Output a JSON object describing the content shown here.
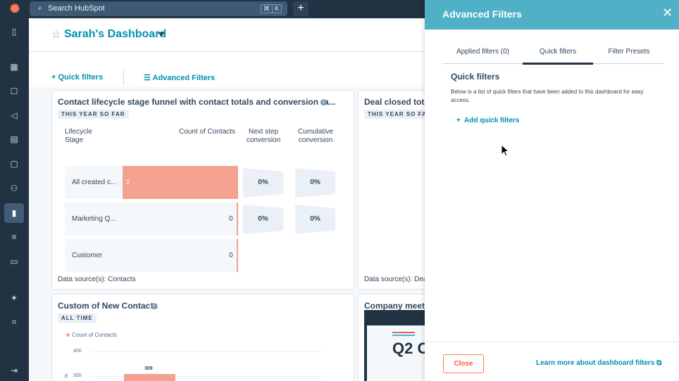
{
  "topbar": {
    "logo_glyph": "✺",
    "search_placeholder": "Search HubSpot",
    "shortcut_cmd": "⌘",
    "shortcut_key": "K",
    "add_glyph": "+"
  },
  "rail_icons": [
    "bookmark-icon",
    "contacts-icon",
    "grid-icon",
    "inbox-icon",
    "megaphone-icon",
    "content-icon",
    "commerce-icon",
    "automation-icon",
    "reports-icon",
    "database-icon",
    "folder-icon",
    "sparkle-icon",
    "code-icon",
    "collapse-icon"
  ],
  "dashboard": {
    "title": "Sarah's Dashboard",
    "filters": {
      "quick": "Quick filters",
      "advanced": "Advanced Filters"
    }
  },
  "card1": {
    "title": "Contact lifecycle stage funnel with contact totals and conversion ra...",
    "tag": "THIS YEAR SO FAR",
    "col_stage": "Lifecycle\nStage",
    "col_count": "Count of Contacts",
    "col_next": "Next step\nconversion",
    "col_cum": "Cumulative\nconversion",
    "rows": [
      {
        "label": "All created c...",
        "value": "2",
        "next": "0%",
        "cum": "0%"
      },
      {
        "label": "Marketing Q...",
        "value": "0",
        "next": "0%",
        "cum": "0%"
      },
      {
        "label": "Customer",
        "value": "0"
      }
    ],
    "source": "Data source(s): Contacts"
  },
  "card2": {
    "title": "Deal closed tota",
    "tag": "THIS YEAR SO FAR",
    "source": "Data source(s): Dea"
  },
  "card3": {
    "title": "Custom of New Contacts",
    "tag": "ALL TIME",
    "legend": "Count of Contacts",
    "ticks": [
      "400",
      "300"
    ],
    "bar_label": "309",
    "ylabel": "ts"
  },
  "chart_data": {
    "type": "bar",
    "title": "Custom of New Contacts",
    "series": [
      {
        "name": "Count of Contacts",
        "values": [
          309
        ]
      }
    ],
    "ylim": [
      0,
      400
    ]
  },
  "card4": {
    "title": "Company meetin",
    "slide_text": "Q2 C"
  },
  "panel": {
    "title": "Advanced Filters",
    "tabs": [
      "Applied filters (0)",
      "Quick filters",
      "Filter Presets"
    ],
    "section_title": "Quick filters",
    "description": "Below is a list of quick filters that have been added to this dashboard for easy access.",
    "add_label": "Add quick filters",
    "close_label": "Close",
    "learn_more": "Learn more about dashboard filters"
  }
}
